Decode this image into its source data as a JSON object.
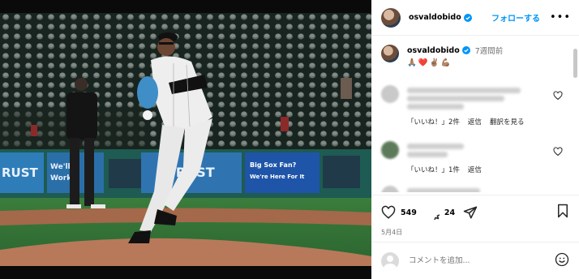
{
  "post": {
    "username": "osvaldobido",
    "follow_label": "フォローする",
    "more_label": "•••",
    "time_ago": "7週間前",
    "caption_emoji": "🙏🏽❤️✌🏽💪🏽",
    "likes": "549",
    "comments": "24",
    "date": "5月4日",
    "comment_placeholder": "コメントを追加..."
  },
  "photo": {
    "banner_left": "RUST",
    "banner_mid_top": "We'll",
    "banner_mid_bottom": "Work",
    "banner_right_big": "TRUST",
    "banner_blue_top": "Big Sox Fan?",
    "banner_blue_bottom": "We're Here For It"
  },
  "comments": [
    {
      "likes_label": "「いいね！」2件",
      "reply_label": "返信",
      "translate_label": "翻訳を見る"
    },
    {
      "likes_label": "「いいね！」1件",
      "reply_label": "返信"
    }
  ],
  "colors": {
    "accent": "#0095f6",
    "verified": "#0095f6",
    "heart": "#ed4956"
  }
}
